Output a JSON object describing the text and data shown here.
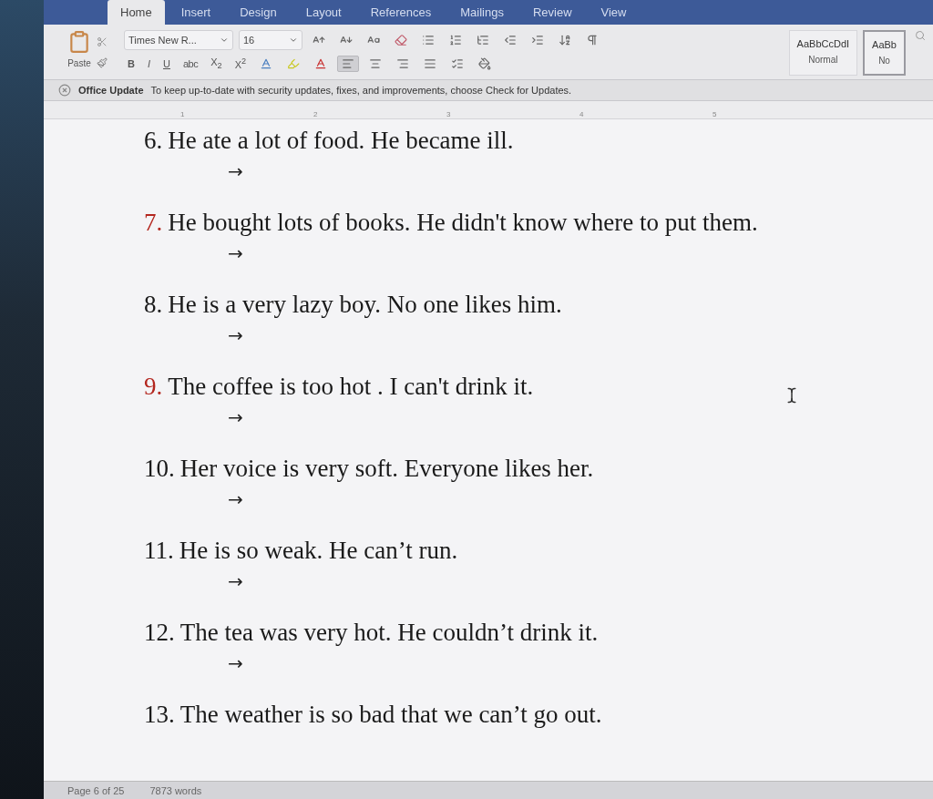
{
  "tabs": [
    {
      "label": "Home",
      "selected": true
    },
    {
      "label": "Insert",
      "selected": false
    },
    {
      "label": "Design",
      "selected": false
    },
    {
      "label": "Layout",
      "selected": false
    },
    {
      "label": "References",
      "selected": false
    },
    {
      "label": "Mailings",
      "selected": false
    },
    {
      "label": "Review",
      "selected": false
    },
    {
      "label": "View",
      "selected": false
    }
  ],
  "ribbon": {
    "paste_label": "Paste",
    "font_name": "Times New R...",
    "font_size": "16",
    "format_buttons": [
      {
        "kind": "bold",
        "label": "B"
      },
      {
        "kind": "italic",
        "label": "I"
      },
      {
        "kind": "underline",
        "label": "U"
      },
      {
        "kind": "strike",
        "label": "abc"
      },
      {
        "kind": "subscript",
        "label": "X$_{2}$"
      },
      {
        "kind": "superscript",
        "label": "X$^{2}$"
      }
    ],
    "alignment": [
      {
        "kind": "left",
        "selected": true
      },
      {
        "kind": "center",
        "selected": false
      },
      {
        "kind": "right",
        "selected": false
      },
      {
        "kind": "justify",
        "selected": false
      }
    ],
    "styles": [
      {
        "preview": "AaBbCcDdI",
        "name": "Normal",
        "selected": false
      },
      {
        "preview": "AaBb",
        "name": "No",
        "selected": true
      }
    ]
  },
  "notification": {
    "title": "Office Update",
    "message": "To keep up-to-date with security updates, fixes, and improvements, choose Check for Updates."
  },
  "ruler": {
    "marks": [
      "1",
      "2",
      "3",
      "4",
      "5"
    ]
  },
  "exercises": [
    {
      "number": "6.",
      "text": "He ate a lot of food. He became ill.",
      "color": "#1a1a1a",
      "arrow": "→"
    },
    {
      "number": "7.",
      "text": "He bought lots of books. He didn't know where to put them.",
      "color": "#b3261e",
      "arrow": "→"
    },
    {
      "number": "8.",
      "text": "He is a very lazy boy. No one likes him.",
      "color": "#1a1a1a",
      "arrow": "→"
    },
    {
      "number": "9.",
      "text": "The coffee is too hot . I can't drink it.",
      "color": "#b3261e",
      "arrow": "→"
    },
    {
      "number": "10.",
      "text": "Her voice is very soft. Everyone likes her.",
      "color": "#1a1a1a",
      "arrow": "→"
    },
    {
      "number": "11.",
      "text": "He is so weak. He can’t run.",
      "color": "#1a1a1a",
      "arrow": "→"
    },
    {
      "number": "12.",
      "text": "The tea was very hot. He couldn’t drink it.",
      "color": "#1a1a1a",
      "arrow": "→"
    },
    {
      "number": "13.",
      "text": "The weather is so bad that we can’t go out.",
      "color": "#1a1a1a"
    }
  ],
  "status_bar": {
    "page": "Page 6 of 25",
    "words": "7873 words"
  }
}
